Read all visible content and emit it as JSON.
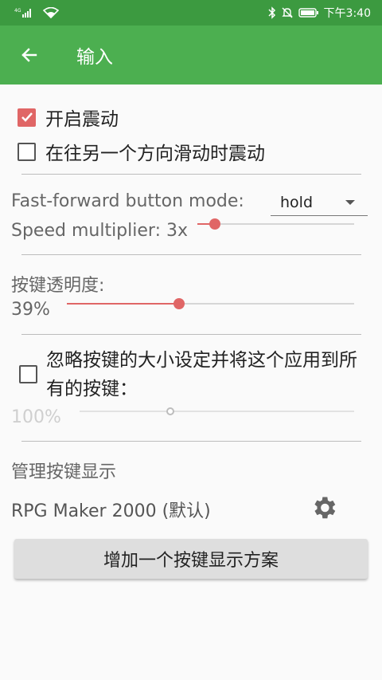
{
  "status_bar": {
    "signal_label": "4G",
    "time": "下午3:40"
  },
  "app_bar": {
    "title": "输入"
  },
  "vibration": {
    "enable_label": "开启震动",
    "enable_checked": true,
    "swipe_label": "在往另一个方向滑动时震动",
    "swipe_checked": false
  },
  "fast_forward": {
    "mode_label": "Fast-forward button mode:",
    "mode_value": "hold",
    "speed_label": "Speed multiplier: 3x",
    "speed_level": 0.11
  },
  "transparency": {
    "label": "按键透明度:",
    "value_text": "39%",
    "level": 0.39
  },
  "ignore_size": {
    "label": "忽略按键的大小设定并将这个应用到所有的按键：",
    "checked": false,
    "value_text": "100%",
    "level": 0.33
  },
  "layout": {
    "section_title": "管理按键显示",
    "current_layout": "RPG Maker 2000 (默认)",
    "add_button": "增加一个按键显示方案"
  },
  "colors": {
    "app_bar": "#4caf50",
    "status_bar": "#3c9a40",
    "accent": "#e06666"
  },
  "icons": {
    "back": "arrow-left-icon",
    "settings": "gear-icon"
  }
}
